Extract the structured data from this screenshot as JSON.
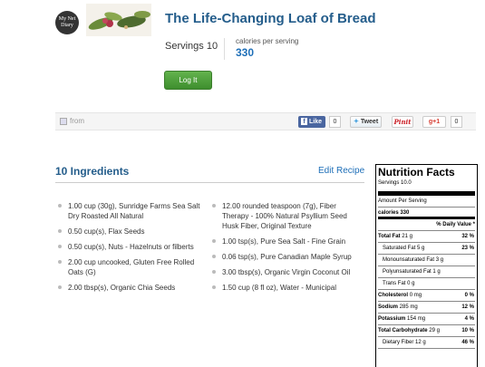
{
  "recipe": {
    "logo_text": "My Net Diary",
    "title": "The Life-Changing Loaf of Bread",
    "servings": "Servings 10",
    "calories_label": "calories per serving",
    "calories_value": "330",
    "login_label": "Log It"
  },
  "share": {
    "from_label": "from",
    "facebook_label": "Like",
    "facebook_count": "0",
    "twitter_label": "Tweet",
    "pinterest_label": "Pinit",
    "gplus_label": "+1",
    "gplus_count": "0"
  },
  "ingredients": {
    "heading": "10 Ingredients",
    "edit_label": "Edit Recipe",
    "left": [
      "1.00 cup (30g), Sunridge Farms Sea Salt Dry Roasted All Natural",
      "0.50 cup(s), Flax Seeds",
      "0.50 cup(s), Nuts - Hazelnuts or filberts",
      "2.00 cup uncooked, Gluten Free Rolled Oats (G)",
      "2.00 tbsp(s), Organic Chia Seeds"
    ],
    "right": [
      "12.00 rounded teaspoon (7g), Fiber Therapy - 100% Natural Psyllium Seed Husk Fiber, Original Texture",
      "1.00 tsp(s), Pure Sea Salt - Fine Grain",
      "0.06 tsp(s), Pure Canadian Maple Syrup",
      "3.00 tbsp(s), Organic Virgin Coconut Oil",
      "1.50 cup (8 fl oz), Water - Municipal"
    ]
  },
  "nutrition": {
    "title": "Nutrition Facts",
    "servings": "Servings 10.0",
    "amount_per_serving": "Amount Per Serving",
    "calories": "calories 330",
    "daily_value": "% Daily Value *",
    "rows": {
      "total_fat": {
        "label": "Total Fat",
        "amount": "21 g",
        "pct": "32 %"
      },
      "sat_fat": {
        "label": "Saturated Fat",
        "amount": "5 g",
        "pct": "23 %"
      },
      "mono_fat": {
        "label": "Monounsaturated Fat",
        "amount": "3 g"
      },
      "poly_fat": {
        "label": "Polyunsaturated Fat",
        "amount": "1 g"
      },
      "trans_fat": {
        "label": "Trans Fat",
        "amount": "0 g"
      },
      "cholesterol": {
        "label": "Cholesterol",
        "amount": "0 mg",
        "pct": "0 %"
      },
      "sodium": {
        "label": "Sodium",
        "amount": "285 mg",
        "pct": "12 %"
      },
      "potassium": {
        "label": "Potassium",
        "amount": "154 mg",
        "pct": "4 %"
      },
      "carbs": {
        "label": "Total Carbohydrate",
        "amount": "29 g",
        "pct": "10 %"
      },
      "fiber": {
        "label": "Dietary Fiber",
        "amount": "12 g",
        "pct": "46 %"
      }
    }
  },
  "colors": {
    "title_blue": "#245d8b",
    "link_blue": "#1e6fb8",
    "login_green": "#4fa23b",
    "facebook_blue": "#4a66a0"
  }
}
